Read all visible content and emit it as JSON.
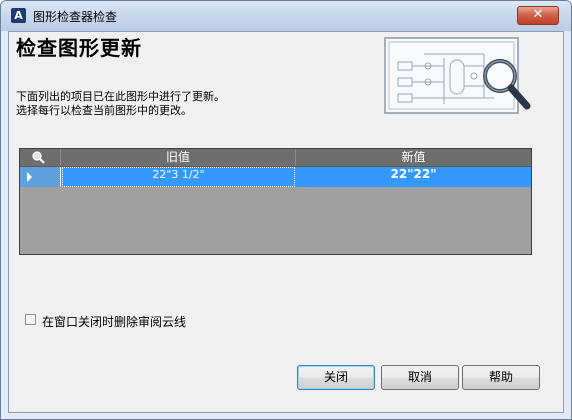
{
  "window": {
    "title": "图形检查器检查",
    "close_glyph": "✕",
    "app_icon_glyph": "A"
  },
  "main": {
    "heading": "检查图形更新",
    "description_line1": "下面列出的项目已在此图形中进行了更新。",
    "description_line2": "选择每行以检查当前图形中的更改。"
  },
  "grid": {
    "header_icon": "magnifier-icon",
    "columns": [
      "旧值",
      "新值"
    ],
    "rows": [
      {
        "old": "22\"3 1/2\"",
        "new": "22\"22\"",
        "selected": true
      }
    ]
  },
  "options": {
    "delete_revision_clouds_label": "在窗口关闭时删除审阅云线",
    "delete_revision_clouds_checked": false
  },
  "buttons": {
    "close": "关闭",
    "cancel": "取消",
    "help": "帮助"
  },
  "colors": {
    "selection": "#3399ff",
    "grid_header": "#6e6e6e",
    "grid_body": "#a0a0a0",
    "title_close": "#c2402a"
  }
}
